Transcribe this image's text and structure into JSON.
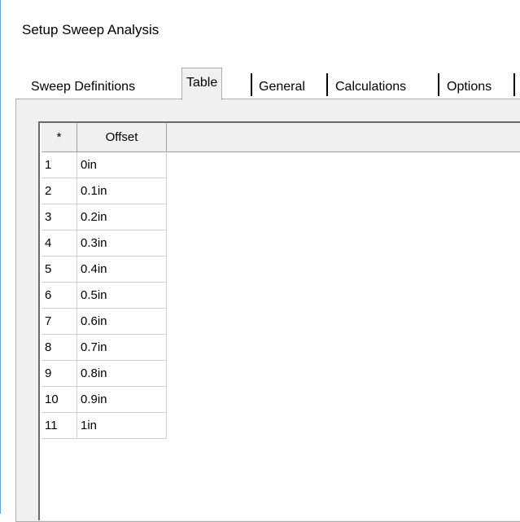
{
  "window": {
    "title": "Setup Sweep Analysis"
  },
  "tabs": [
    {
      "label": "Sweep Definitions",
      "active": false
    },
    {
      "label": "Table",
      "active": true
    },
    {
      "label": "General",
      "active": false
    },
    {
      "label": "Calculations",
      "active": false
    },
    {
      "label": "Options",
      "active": false
    }
  ],
  "table": {
    "columns": [
      "*",
      "Offset"
    ],
    "rows": [
      {
        "index": "1",
        "offset": "0in"
      },
      {
        "index": "2",
        "offset": "0.1in"
      },
      {
        "index": "3",
        "offset": "0.2in"
      },
      {
        "index": "4",
        "offset": "0.3in"
      },
      {
        "index": "5",
        "offset": "0.4in"
      },
      {
        "index": "6",
        "offset": "0.5in"
      },
      {
        "index": "7",
        "offset": "0.6in"
      },
      {
        "index": "8",
        "offset": "0.7in"
      },
      {
        "index": "9",
        "offset": "0.8in"
      },
      {
        "index": "10",
        "offset": "0.9in"
      },
      {
        "index": "11",
        "offset": "1in"
      }
    ]
  }
}
